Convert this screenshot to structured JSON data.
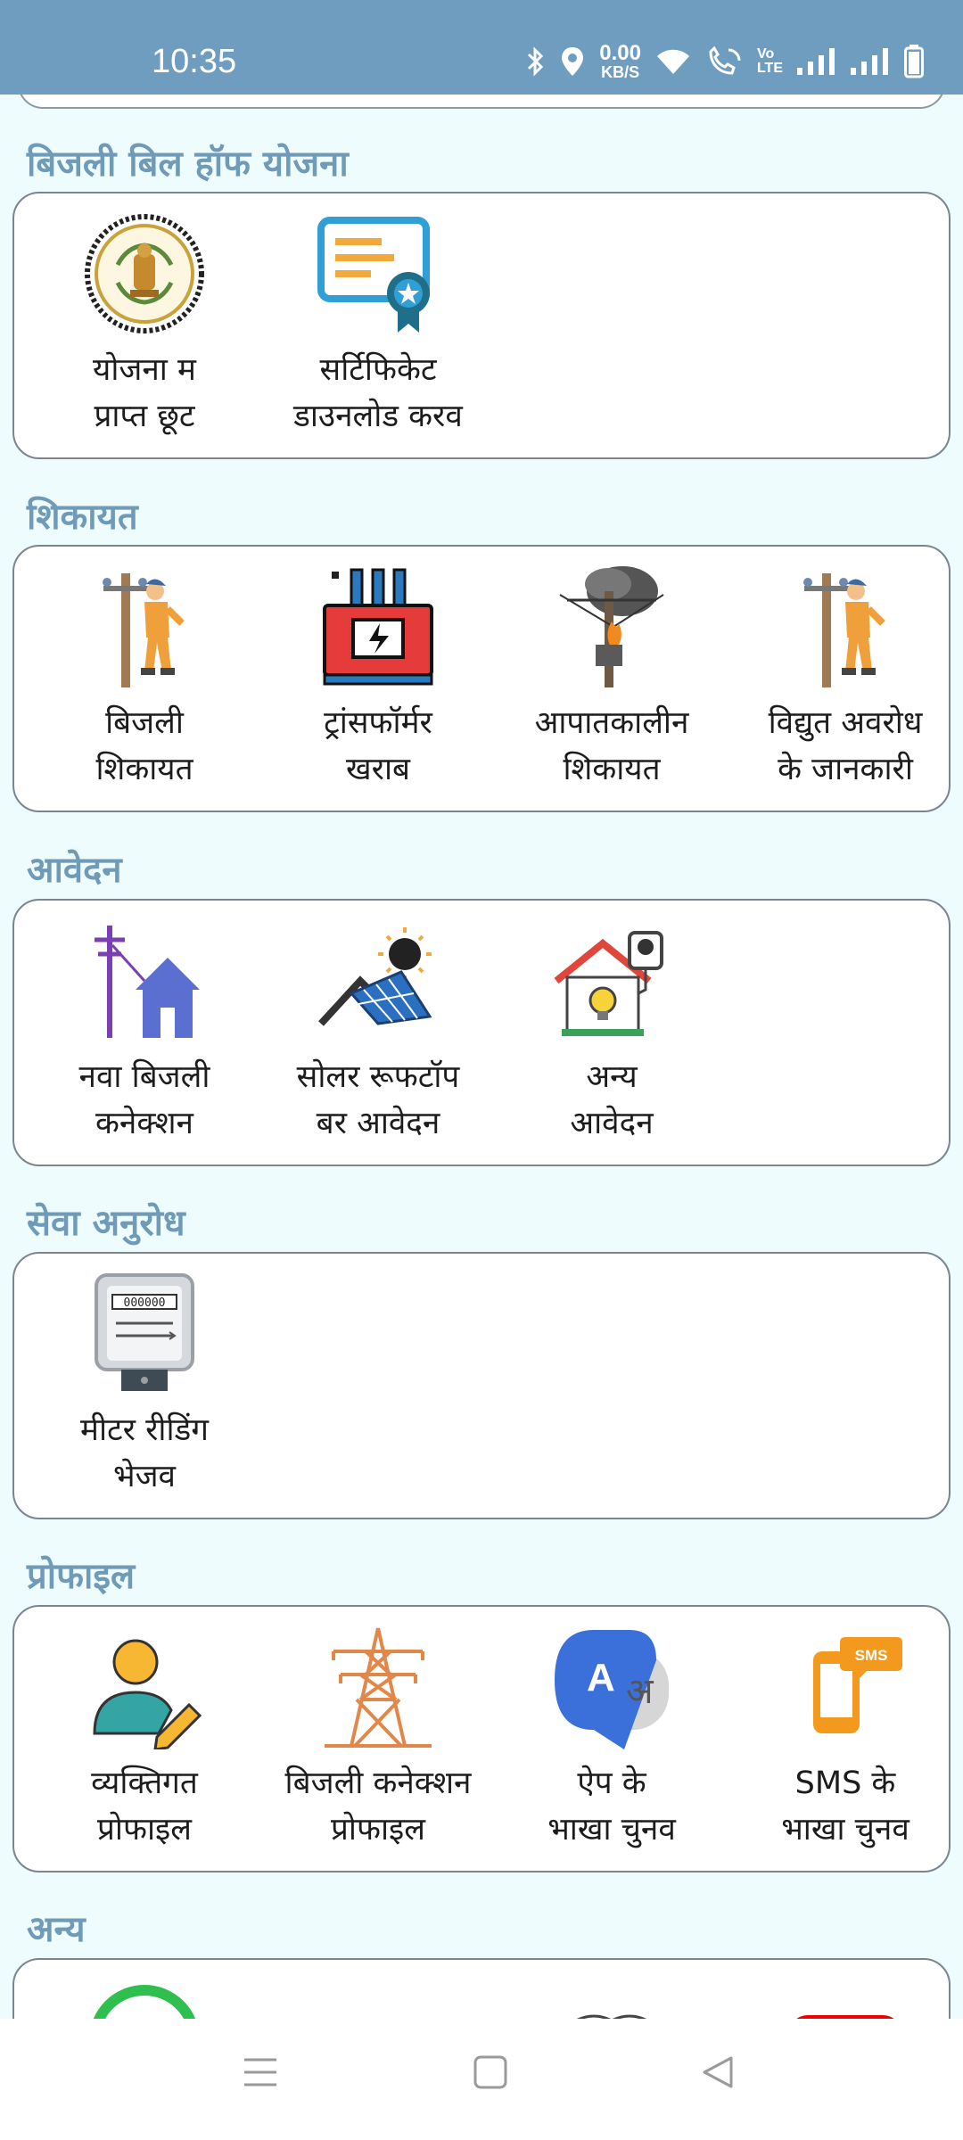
{
  "status_bar": {
    "time": "10:35",
    "net_speed_value": "0.00",
    "net_speed_unit": "KB/S",
    "volte_top": "Vo",
    "volte_bottom": "LTE",
    "icons": [
      "bluetooth-icon",
      "location-icon",
      "wifi-icon",
      "wifi-calling-icon",
      "volte-icon",
      "signal-icon",
      "signal-icon",
      "battery-icon"
    ]
  },
  "sections": {
    "scheme": {
      "title": "बिजली बिल हॉफ योजना",
      "items": [
        {
          "label": "योजना म\nप्राप्त छूट",
          "icon": "government-emblem-icon"
        },
        {
          "label": "सर्टिफिकेट\nडाउनलोड करव",
          "icon": "certificate-icon"
        }
      ]
    },
    "complaint": {
      "title": "शिकायत",
      "items": [
        {
          "label": "बिजली\nशिकायत",
          "icon": "lineman-icon"
        },
        {
          "label": "ट्रांसफॉर्मर\nखराब",
          "icon": "transformer-icon"
        },
        {
          "label": "आपातकालीन\nशिकायत",
          "icon": "fire-pole-icon"
        },
        {
          "label": "विद्युत अवरोध\nके जानकारी",
          "icon": "lineman-icon"
        }
      ]
    },
    "application": {
      "title": "आवेदन",
      "items": [
        {
          "label": "नवा बिजली\nकनेक्शन",
          "icon": "house-connection-icon"
        },
        {
          "label": "सोलर रूफटॉप\nबर आवेदन",
          "icon": "solar-roof-icon"
        },
        {
          "label": "अन्य\nआवेदन",
          "icon": "house-bulb-icon"
        }
      ]
    },
    "service": {
      "title": "सेवा अनुरोध",
      "items": [
        {
          "label": "मीटर रीडिंग\nभेजव",
          "icon": "electric-meter-icon",
          "meter_digits": "000000"
        }
      ]
    },
    "profile": {
      "title": "प्रोफाइल",
      "items": [
        {
          "label": "व्यक्तिगत\nप्रोफाइल",
          "icon": "user-edit-icon"
        },
        {
          "label": "बिजली कनेक्शन\nप्रोफाइल",
          "icon": "transmission-tower-icon"
        },
        {
          "label": "ऐप के\nभाखा चुनव",
          "icon": "translate-icon",
          "glyph_a": "A",
          "glyph_b": "अ"
        },
        {
          "label": "SMS के\nभाखा चुनव",
          "icon": "sms-phone-icon",
          "badge": "SMS"
        }
      ]
    },
    "other": {
      "title": "अन्य",
      "items": [
        {
          "icon": "whatsapp-icon"
        },
        {
          "icon": "blue-shape-icon"
        },
        {
          "icon": "book-icon"
        },
        {
          "icon": "youtube-icon"
        }
      ]
    }
  },
  "nav": {
    "icons": [
      "menu-icon",
      "home-square-icon",
      "back-triangle-icon"
    ]
  },
  "colors": {
    "status_bar": "#6e9dc0",
    "section_title": "#6f9ab8",
    "card_border": "#7b858e",
    "content_bg": "#eefcfd"
  }
}
